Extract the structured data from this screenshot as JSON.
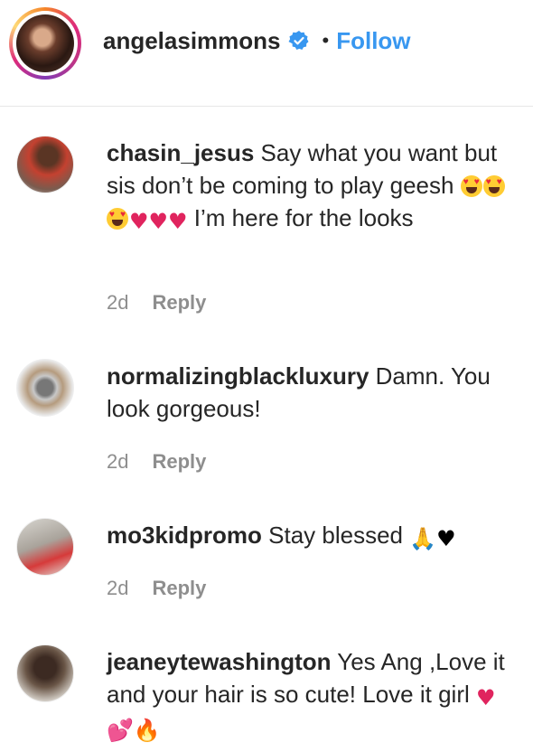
{
  "header": {
    "username": "angelasimmons",
    "separator": "•",
    "follow_label": "Follow"
  },
  "comments": [
    {
      "username": "chasin_jesus",
      "text_1": "Say what you want but sis don’t be coming to play geesh",
      "text_2": "I’m here for the looks",
      "emojis": "😍😍😍❤️❤️❤️",
      "age": "2d",
      "reply_label": "Reply"
    },
    {
      "username": "normalizingblackluxury",
      "text_1": "Damn. You look gorgeous!",
      "age": "2d",
      "reply_label": "Reply"
    },
    {
      "username": "mo3kidpromo",
      "text_1": "Stay blessed",
      "emojis": "🙏🏼🖤",
      "age": "2d",
      "reply_label": "Reply"
    },
    {
      "username": "jeaneytewashington",
      "text_1": "Yes Ang ,Love it and your hair is so cute! Love it girl",
      "emojis": "❤️💕🔥"
    }
  ],
  "colors": {
    "accent": "#3897f0",
    "verified": "#3897f0",
    "muted": "#8e8e8e",
    "text": "#262626"
  },
  "icons": [
    "verified-badge-icon"
  ]
}
